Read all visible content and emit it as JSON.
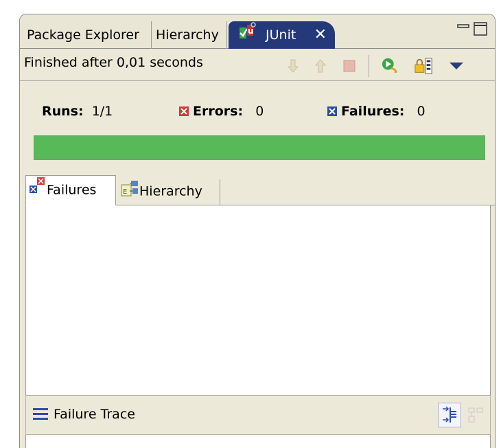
{
  "tabs": {
    "package_explorer": "Package Explorer",
    "hierarchy": "Hierarchy",
    "junit": "JUnit"
  },
  "toolbar": {
    "status": "Finished after 0,01 seconds"
  },
  "counters": {
    "runs_label": "Runs:",
    "runs_value": "1/1",
    "errors_label": "Errors:",
    "errors_value": "0",
    "failures_label": "Failures:",
    "failures_value": "0"
  },
  "progress": {
    "fraction": 1.0,
    "color": "#58b958"
  },
  "subtabs": {
    "failures": "Failures",
    "hierarchy": "Hierarchy"
  },
  "trace": {
    "label": "Failure Trace"
  },
  "colors": {
    "active_tab": "#24387a",
    "error_red": "#d23a3a",
    "failure_blue": "#2a4ea8"
  }
}
